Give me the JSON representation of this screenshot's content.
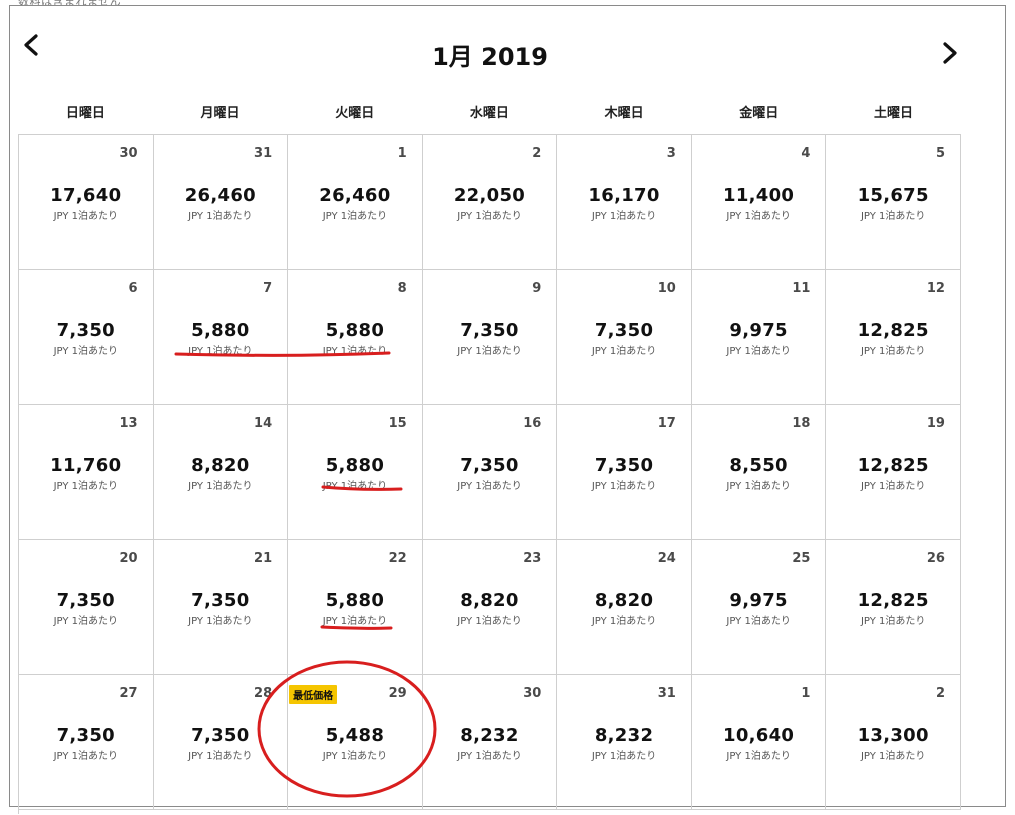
{
  "top_clip_text": "数料は含まれません",
  "calendar": {
    "title": "1月 2019",
    "weekdays": [
      "日曜日",
      "月曜日",
      "火曜日",
      "水曜日",
      "木曜日",
      "金曜日",
      "土曜日"
    ],
    "unit_label": "JPY 1泊あたり",
    "lowest_badge": "最低価格",
    "days": [
      {
        "day": "30",
        "price": "17,640"
      },
      {
        "day": "31",
        "price": "26,460"
      },
      {
        "day": "1",
        "price": "26,460"
      },
      {
        "day": "2",
        "price": "22,050"
      },
      {
        "day": "3",
        "price": "16,170"
      },
      {
        "day": "4",
        "price": "11,400"
      },
      {
        "day": "5",
        "price": "15,675"
      },
      {
        "day": "6",
        "price": "7,350"
      },
      {
        "day": "7",
        "price": "5,880"
      },
      {
        "day": "8",
        "price": "5,880"
      },
      {
        "day": "9",
        "price": "7,350"
      },
      {
        "day": "10",
        "price": "7,350"
      },
      {
        "day": "11",
        "price": "9,975"
      },
      {
        "day": "12",
        "price": "12,825"
      },
      {
        "day": "13",
        "price": "11,760"
      },
      {
        "day": "14",
        "price": "8,820"
      },
      {
        "day": "15",
        "price": "5,880"
      },
      {
        "day": "16",
        "price": "7,350"
      },
      {
        "day": "17",
        "price": "7,350"
      },
      {
        "day": "18",
        "price": "8,550"
      },
      {
        "day": "19",
        "price": "12,825"
      },
      {
        "day": "20",
        "price": "7,350"
      },
      {
        "day": "21",
        "price": "7,350"
      },
      {
        "day": "22",
        "price": "5,880"
      },
      {
        "day": "23",
        "price": "8,820"
      },
      {
        "day": "24",
        "price": "8,820"
      },
      {
        "day": "25",
        "price": "9,975"
      },
      {
        "day": "26",
        "price": "12,825"
      },
      {
        "day": "27",
        "price": "7,350"
      },
      {
        "day": "28",
        "price": "7,350"
      },
      {
        "day": "29",
        "price": "5,488",
        "lowest": true
      },
      {
        "day": "30",
        "price": "8,232"
      },
      {
        "day": "31",
        "price": "8,232"
      },
      {
        "day": "1",
        "price": "10,640"
      },
      {
        "day": "2",
        "price": "13,300"
      }
    ]
  },
  "colors": {
    "badge": "#f5c500",
    "annotation": "#d81e1e"
  }
}
